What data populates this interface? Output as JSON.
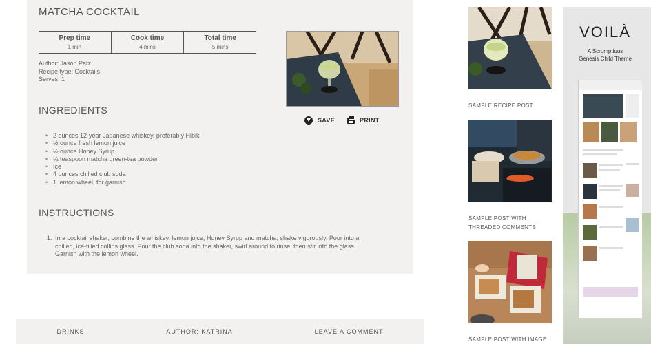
{
  "recipe": {
    "title": "MATCHA COCKTAIL",
    "times": [
      {
        "label": "Prep time",
        "value": "1 min"
      },
      {
        "label": "Cook time",
        "value": "4 mins"
      },
      {
        "label": "Total time",
        "value": "5 mins"
      }
    ],
    "author": "Author: Jason Patz",
    "recipe_type": "Recipe type: Cocktails",
    "serves": "Serves: 1",
    "save_label": "SAVE",
    "print_label": "PRINT",
    "ingredients_heading": "INGREDIENTS",
    "ingredients": [
      "2 ounces 12-year Japanese whiskey, preferably Hibiki",
      "½ ounce fresh lemon juice",
      "½ ounce Honey Syrup",
      "¼ teaspoon matcha green-tea powder",
      "Ice",
      "4 ounces chilled club soda",
      "1 lemon wheel, for garnish"
    ],
    "instructions_heading": "INSTRUCTIONS",
    "instructions": [
      {
        "num": "1.",
        "lines": [
          "In a cocktail shaker, combine the whiskey, lemon juice, Honey Syrup and matcha; shake vigorously. Pour into a",
          "chilled, ice-filled collins glass. Pour the club soda into the shaker, swirl around to rinse, then stir into the glass.",
          "Garnish with the lemon wheel."
        ]
      }
    ]
  },
  "post_meta": {
    "category": "DRINKS",
    "author": "AUTHOR: KATRINA",
    "comment": "LEAVE A COMMENT"
  },
  "sidebar": {
    "posts": [
      {
        "title": "SAMPLE RECIPE POST"
      },
      {
        "title": "SAMPLE POST WITH THREADED COMMENTS"
      },
      {
        "title": "SAMPLE POST WITH IMAGE"
      }
    ]
  },
  "ad": {
    "title": "VOILÀ",
    "line1": "A Scrumptious",
    "line2": "Genesis Child Theme"
  },
  "colors": {
    "card_background": "#f2f1ef",
    "text": "#5a5a5a",
    "heading": "#555555"
  }
}
